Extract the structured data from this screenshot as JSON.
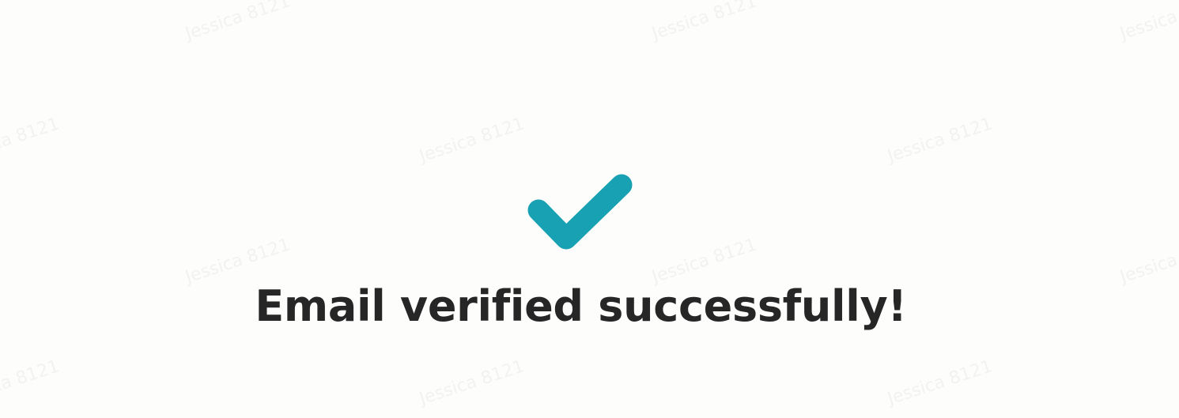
{
  "watermark_text": "Jessica 8121",
  "status": {
    "icon": "checkmark-icon",
    "message": "Email verified successfully!",
    "accent_color": "#17a1b3"
  }
}
